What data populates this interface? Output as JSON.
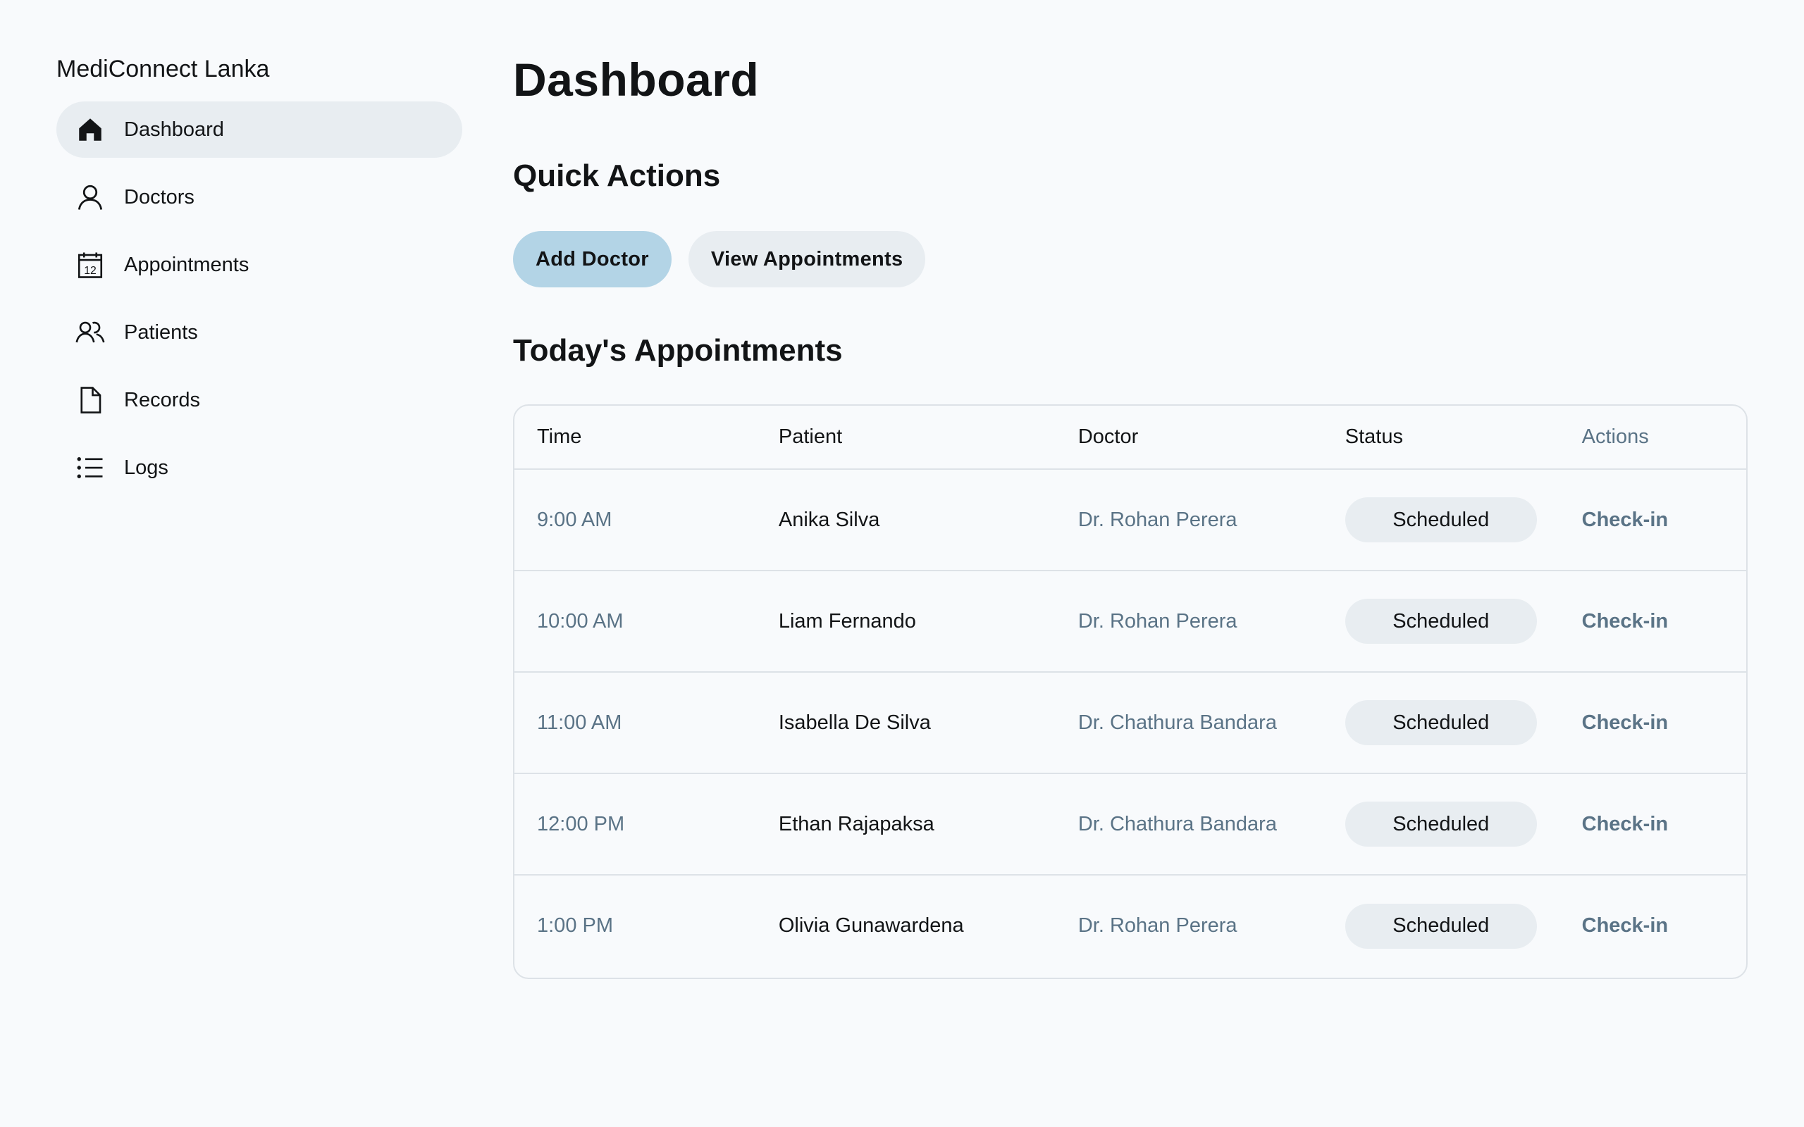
{
  "app": {
    "brand": "MediConnect Lanka"
  },
  "sidebar": {
    "items": [
      {
        "label": "Dashboard",
        "icon": "home-icon",
        "active": true
      },
      {
        "label": "Doctors",
        "icon": "user-icon",
        "active": false
      },
      {
        "label": "Appointments",
        "icon": "calendar-icon",
        "active": false
      },
      {
        "label": "Patients",
        "icon": "users-icon",
        "active": false
      },
      {
        "label": "Records",
        "icon": "file-icon",
        "active": false
      },
      {
        "label": "Logs",
        "icon": "list-icon",
        "active": false
      }
    ],
    "calendar_day": "12"
  },
  "main": {
    "title": "Dashboard",
    "quick_actions": {
      "title": "Quick Actions",
      "add_doctor": "Add Doctor",
      "view_appointments": "View Appointments"
    },
    "appointments": {
      "title": "Today's Appointments",
      "columns": [
        "Time",
        "Patient",
        "Doctor",
        "Status",
        "Actions"
      ],
      "rows": [
        {
          "time": "9:00 AM",
          "patient": "Anika Silva",
          "doctor": "Dr. Rohan Perera",
          "status": "Scheduled",
          "action": "Check-in"
        },
        {
          "time": "10:00 AM",
          "patient": "Liam Fernando",
          "doctor": "Dr. Rohan Perera",
          "status": "Scheduled",
          "action": "Check-in"
        },
        {
          "time": "11:00 AM",
          "patient": "Isabella De Silva",
          "doctor": "Dr. Chathura Bandara",
          "status": "Scheduled",
          "action": "Check-in"
        },
        {
          "time": "12:00 PM",
          "patient": "Ethan Rajapaksa",
          "doctor": "Dr. Chathura Bandara",
          "status": "Scheduled",
          "action": "Check-in"
        },
        {
          "time": "1:00 PM",
          "patient": "Olivia Gunawardena",
          "doctor": "Dr. Rohan Perera",
          "status": "Scheduled",
          "action": "Check-in"
        }
      ]
    }
  },
  "colors": {
    "background": "#f8fafc",
    "primary_button": "#b3d4e6",
    "secondary_button": "#e8edf1",
    "muted_text": "#5a7386",
    "border": "#dde2e7"
  }
}
